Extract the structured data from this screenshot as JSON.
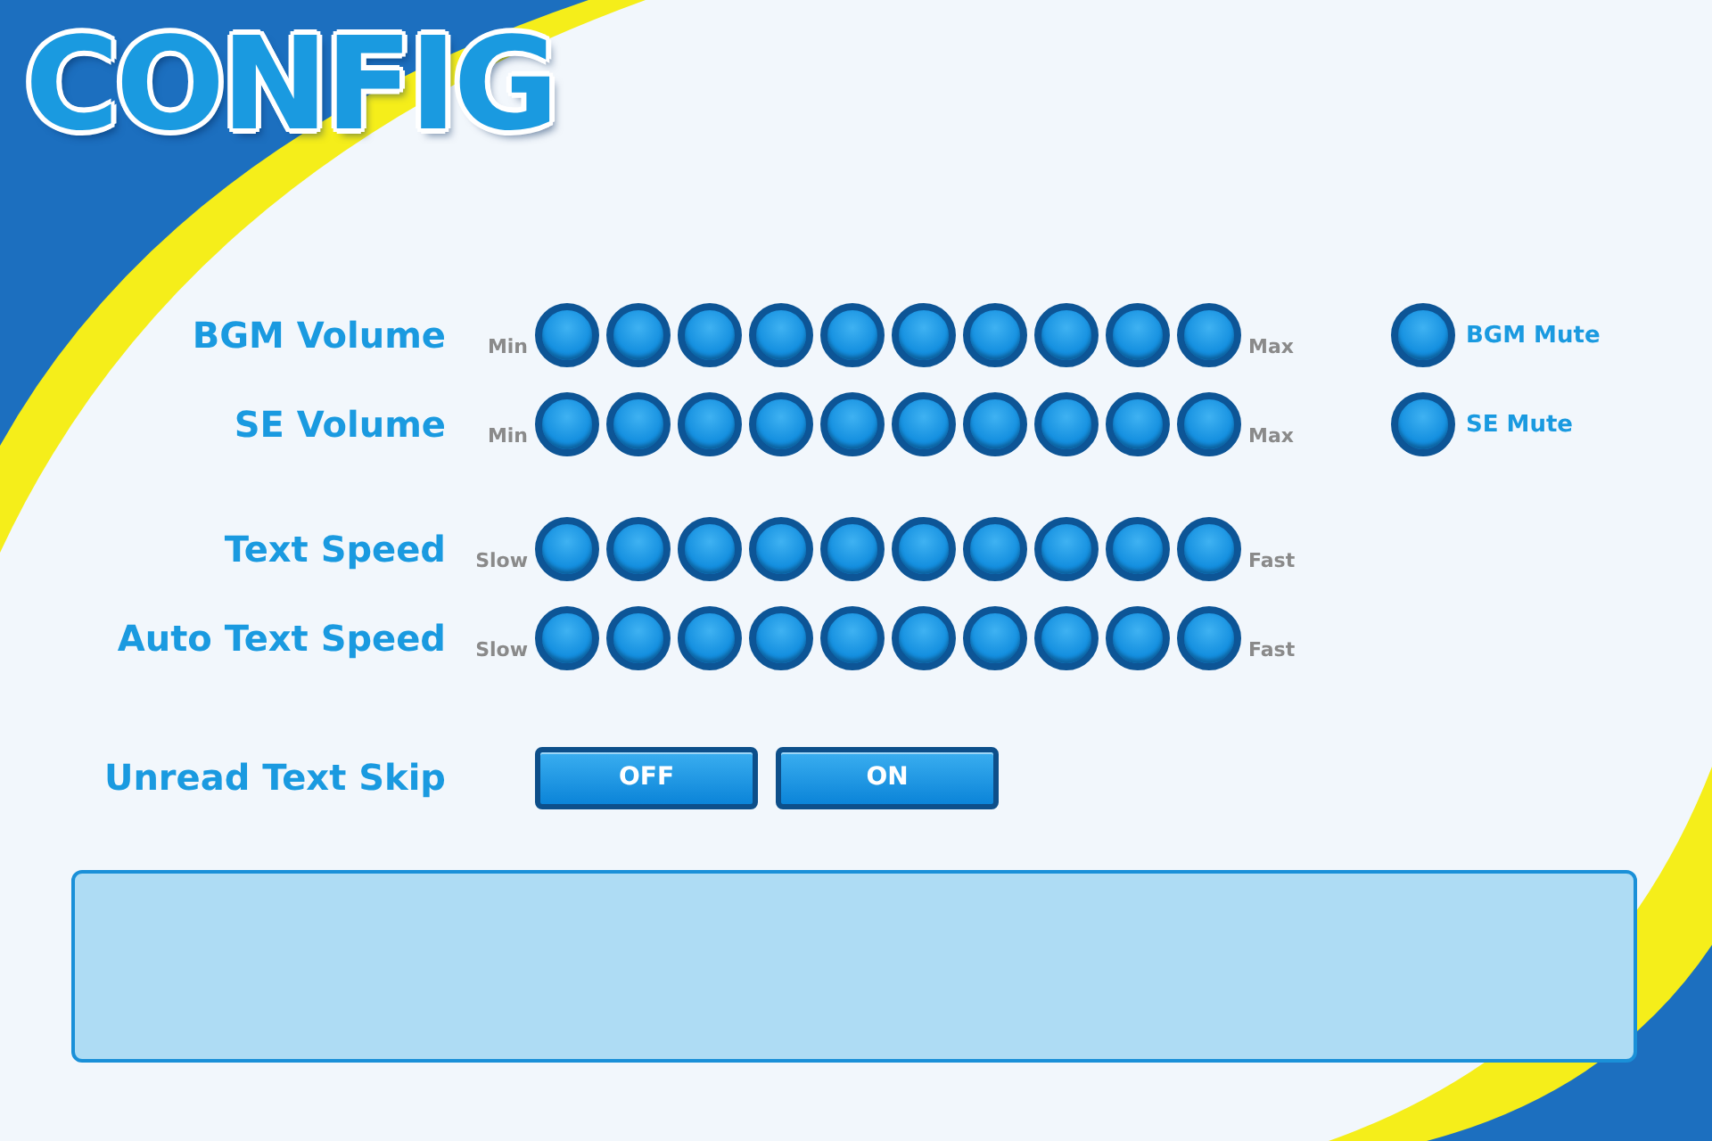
{
  "title": "CONFIG",
  "groups": [
    {
      "rows": [
        {
          "label": "BGM Volume",
          "min_label": "Min",
          "max_label": "Max",
          "mute": {
            "label": "BGM Mute"
          }
        },
        {
          "label": "SE Volume",
          "min_label": "Min",
          "max_label": "Max",
          "mute": {
            "label": "SE Mute"
          }
        }
      ]
    },
    {
      "rows": [
        {
          "label": "Text Speed",
          "min_label": "Slow",
          "max_label": "Fast"
        },
        {
          "label": "Auto Text Speed",
          "min_label": "Slow",
          "max_label": "Fast"
        }
      ]
    }
  ],
  "toggle": {
    "label": "Unread Text Skip",
    "options": [
      "OFF",
      "ON"
    ]
  }
}
